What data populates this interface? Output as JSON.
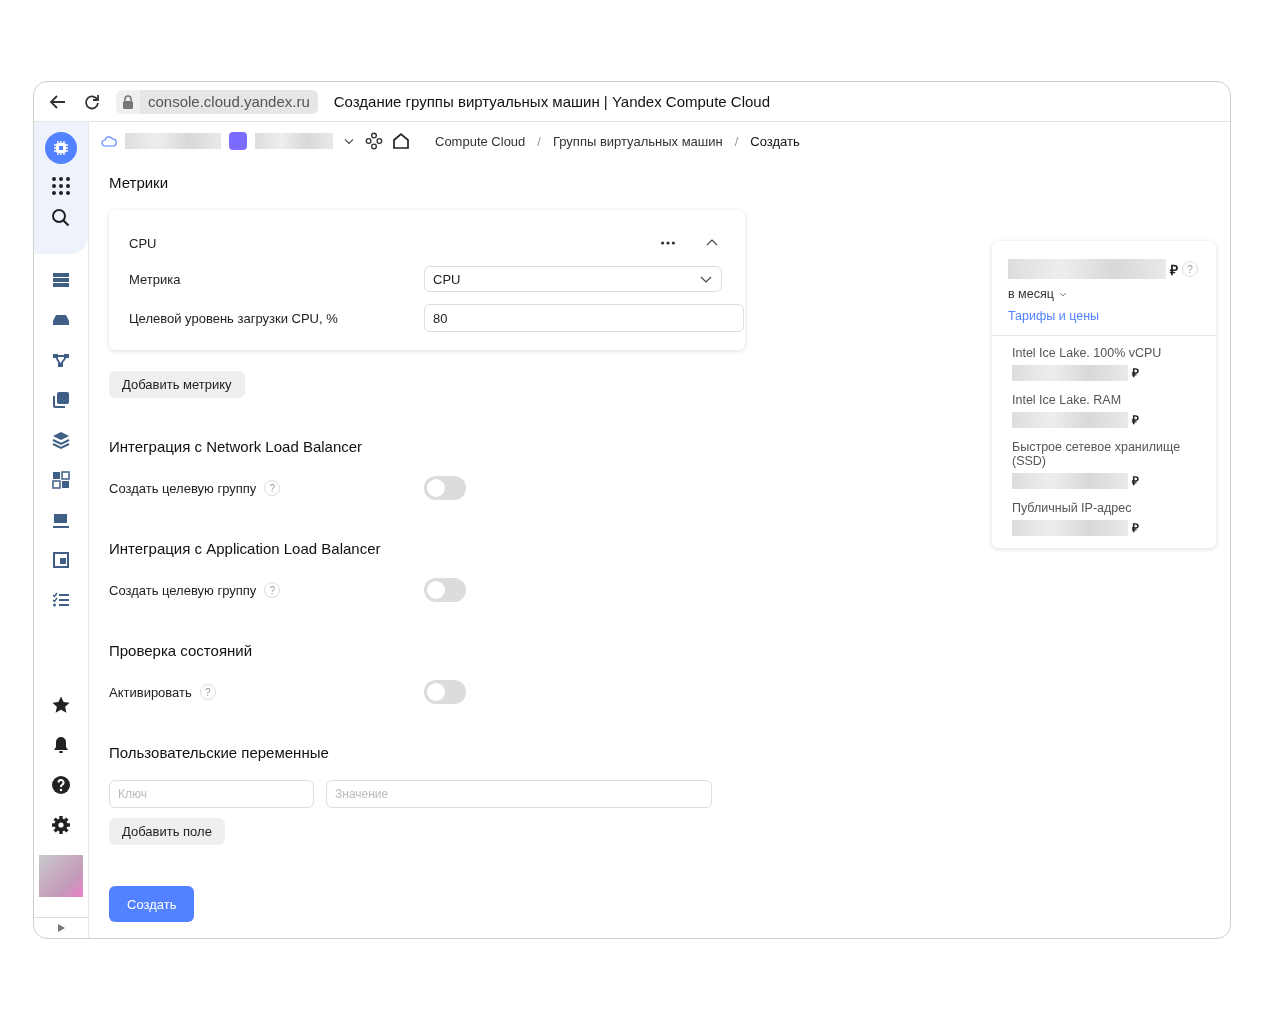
{
  "browser": {
    "url": "console.cloud.yandex.ru",
    "title": "Создание группы виртуальных машин | Yandex Compute Cloud"
  },
  "breadcrumbs": [
    {
      "label": "Compute Cloud"
    },
    {
      "separator": "/",
      "label": "Группы виртуальных машин"
    },
    {
      "separator": "/",
      "label": "Создать"
    }
  ],
  "metrics": {
    "title": "Метрики",
    "card": {
      "title": "CPU",
      "expanded": true,
      "fields": [
        {
          "kind": "select",
          "label": "Метрика",
          "value": "CPU"
        },
        {
          "kind": "input",
          "label": "Целевой уровень загрузки CPU, %",
          "value": "80"
        }
      ]
    },
    "add_button": "Добавить метрику"
  },
  "toggle_sections": [
    {
      "title": "Интеграция с Network Load Balancer",
      "label": "Создать целевую группу",
      "help": "?",
      "on": false
    },
    {
      "title": "Интеграция с Application Load Balancer",
      "label": "Создать целевую группу",
      "help": "?",
      "on": false
    },
    {
      "title": "Проверка состояний",
      "label": "Активировать",
      "help": "?",
      "on": false
    }
  ],
  "variables": {
    "title": "Пользовательские переменные",
    "key_field": {
      "placeholder": "Ключ"
    },
    "value_field": {
      "placeholder": "Значение"
    },
    "add_button": "Добавить поле"
  },
  "submit": "Создать",
  "price": {
    "currency": "₽",
    "help": "?",
    "period": "в месяц",
    "link": "Тарифы и цены",
    "items": [
      {
        "name": "Intel Ice Lake. 100% vCPU",
        "currency": "₽"
      },
      {
        "name": "Intel Ice Lake. RAM",
        "currency": "₽"
      },
      {
        "name": "Быстрое сетевое хранилище (SSD)",
        "currency": "₽"
      },
      {
        "name": "Публичный IP-адрес",
        "currency": "₽"
      }
    ]
  }
}
